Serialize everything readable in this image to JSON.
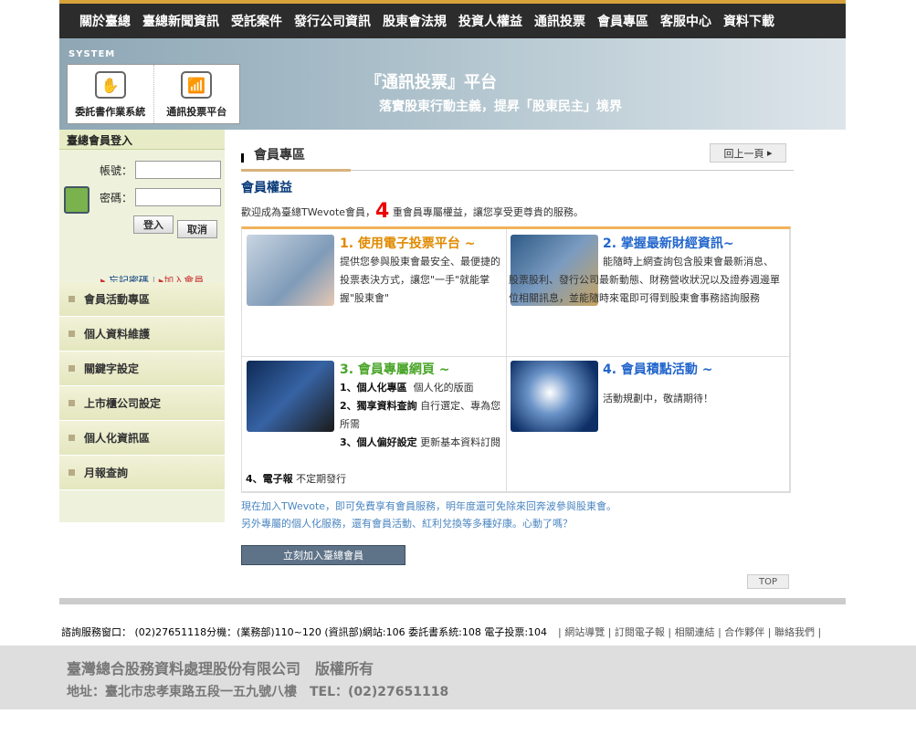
{
  "nav": [
    "關於臺總",
    "臺總新聞資訊",
    "受託案件",
    "發行公司資訊",
    "股東會法規",
    "投資人權益",
    "通訊投票",
    "會員專區",
    "客服中心",
    "資料下載"
  ],
  "banner": {
    "system_label": "SYSTEM",
    "item1": "委託書作業系統",
    "item2": "通訊投票平台",
    "title": "『通訊投票』平台",
    "slogan": "落實股東行動主義，提昇「股東民主」境界"
  },
  "login": {
    "heading": "臺總會員登入",
    "account_label": "帳號：",
    "password_label": "密碼：",
    "login_btn": "登入",
    "cancel_btn": "取消",
    "forgot": "忘記密碼",
    "join": "加入會員"
  },
  "menu": [
    "會員活動專區",
    "個人資料維護",
    "關鍵字設定",
    "上市櫃公司設定",
    "個人化資訊區",
    "月報查詢"
  ],
  "main": {
    "section_title": "會員專區",
    "back": "回上一頁",
    "h2": "會員權益",
    "intro_a": "歡迎成為臺總TWevote會員，",
    "intro_num": "4",
    "intro_b": " 重會員專屬權益，讓您享受更尊貴的服務。",
    "b1_title": "1. 使用電子投票平台 ~",
    "b1_text": "提供您參與股東會最安全、最便捷的投票表決方式，讓您\"一手\"就能掌握\"股東會\"",
    "b2_title": "2. 掌握最新財經資訊~",
    "b2_text": "能隨時上網查詢包含股東會最新消息、股票股利、發行公司最新動態、財務營收狀況以及證券週邊單位相關訊息，並能隨時來電即可得到股東會事務諮詢服務",
    "b3_title": "3. 會員專屬網頁 ~",
    "b3_i1a": "1、個人化專區",
    "b3_i1b": "個人化的版面",
    "b3_i2a": "2、獨享資料查詢",
    "b3_i2b": " 自行選定、專為您所需",
    "b3_i3a": "3、個人偏好設定",
    "b3_i3b": " 更新基本資料訂閱",
    "b3_i4a": "4、電子報",
    "b3_i4b": " 不定期發行",
    "b4_title": "4. 會員積點活動 ~",
    "b4_text": "活動規劃中，敬請期待！",
    "foot1": "現在加入TWevote，即可免費享有會員服務，明年度還可免除來回奔波參與股東會。",
    "foot2": "另外專屬的個人化服務，還有會員活動、紅利兌換等多種好康。心動了嗎？",
    "join_btn": "立刻加入臺總會員",
    "top": "TOP"
  },
  "footer": {
    "service": "諮詢服務窗口： (02)27651118分機：(業務部)110~120 (資訊部)網站:106 委託書系統:108 電子投票:104",
    "links": "| 網站導覽 | 訂閱電子報 | 相關連結 | 合作夥伴 | 聯絡我們 |",
    "copyright": "臺灣總合股務資料處理股份有限公司　版權所有",
    "address": "地址：臺北市忠孝東路五段一五九號八樓　TEL：(02)27651118"
  },
  "colors": {
    "nav_bg": "#2c2c2c",
    "accent": "#d8a23a",
    "left_bg": "#eef2dc",
    "title_orange": "#e08a00",
    "title_blue": "#2266cc",
    "title_green": "#4aa52a"
  }
}
